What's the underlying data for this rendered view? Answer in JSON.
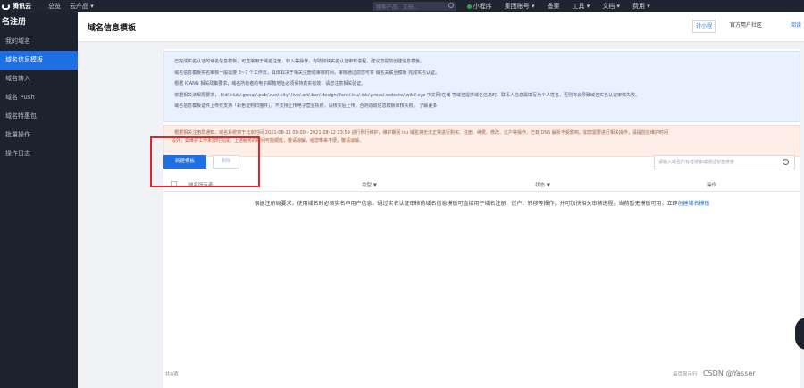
{
  "topbar": {
    "brand": "腾讯云",
    "nav": [
      "总览",
      "云产品 ▾"
    ],
    "search_placeholder": "搜索产品、文档...",
    "right_items": [
      "小程序",
      "集团账号 ▾",
      "备案",
      "工具 ▾",
      "文档 ▾",
      "费用 ▾"
    ]
  },
  "sidebar": {
    "title": "名注册",
    "items": [
      {
        "label": "我的域名",
        "active": false
      },
      {
        "label": "域名信息模板",
        "active": true
      },
      {
        "label": "域名转入",
        "active": false
      },
      {
        "label": "域名 Push",
        "active": false
      },
      {
        "label": "域名特惠包",
        "active": false
      },
      {
        "label": "批量操作",
        "active": false
      },
      {
        "label": "操作日志",
        "active": false
      }
    ]
  },
  "header": {
    "title": "域名信息模板",
    "btn_help": "讨小程",
    "btn_community": "官方用户社区",
    "btn_more": "阅读"
  },
  "notice_blue": [
    "· 已完成实名认证的域名信息模板，可直接用于域名注册、转入等操作，有助加快实名认证审核进程，建议您提前创建信息模板。",
    "· 域名信息模板实名审核一般需要 3~7 个工作日，具体取决于相关注册局审核时间，审核通过前您可将 域名关联至模板 完成实名认证。",
    "· 根据 ICANN 相关政策要求，域名所有者的电子邮箱地址必须保持真实有效，请您注意相关验证。",
    "· 依据相关法规局要求，.bid/.club/.group/.pub/.run/.city/.live/.art/.bar/.design/.fans/.icu/.ink/.press/.website/.wiki/.xyz 中文网/在线 等域名提供域名信息时，联系人信息需填写为个人姓名，否则将会导致域名实名认证审核失败。",
    "· 域名信息模板证件上传仅支持「彩色证照扫描件」，不支持上传电子营业执照，请核实后上传，否则造成信息模板审核失败。 了解更多"
  ],
  "notice_orange": [
    "· 根据相关注册局通知，域名系统将于北京时间 2021-08-11 00:00 - 2021-08-12 23:59 进行例行维护，维护期间 icu 域名将无法正常进行购买、注册、续费、修改、过户等操作，已有 DNS 解析不受影响。如您需要进行相关操作，请提前在维护时间",
    "  段外，如维护工作未按时完成，上述服务的时间可能顺延，敬请谅解，给您带来不便，敬请谅解。"
  ],
  "toolbar": {
    "new_label": "新建模板",
    "delete_label": "删除",
    "filter_placeholder": "请输入域名所有者搜索或通过标签搜索"
  },
  "table": {
    "columns": [
      "域名所有者",
      "类型 ▼",
      "状态 ▼",
      "操作"
    ]
  },
  "empty_state": {
    "text": "根据注册局要求，使用域名时必须实名申用户信息。通过实名认证审核的域名信息模板可直接用于域名注册、过户、转移等操作，并可加快相关审核进程。当前暂无模板可用，立即",
    "link": "创建域名模板"
  },
  "footer": {
    "total": "共0项",
    "per_page": "每页显示行"
  },
  "watermark": "CSDN @Yasser"
}
